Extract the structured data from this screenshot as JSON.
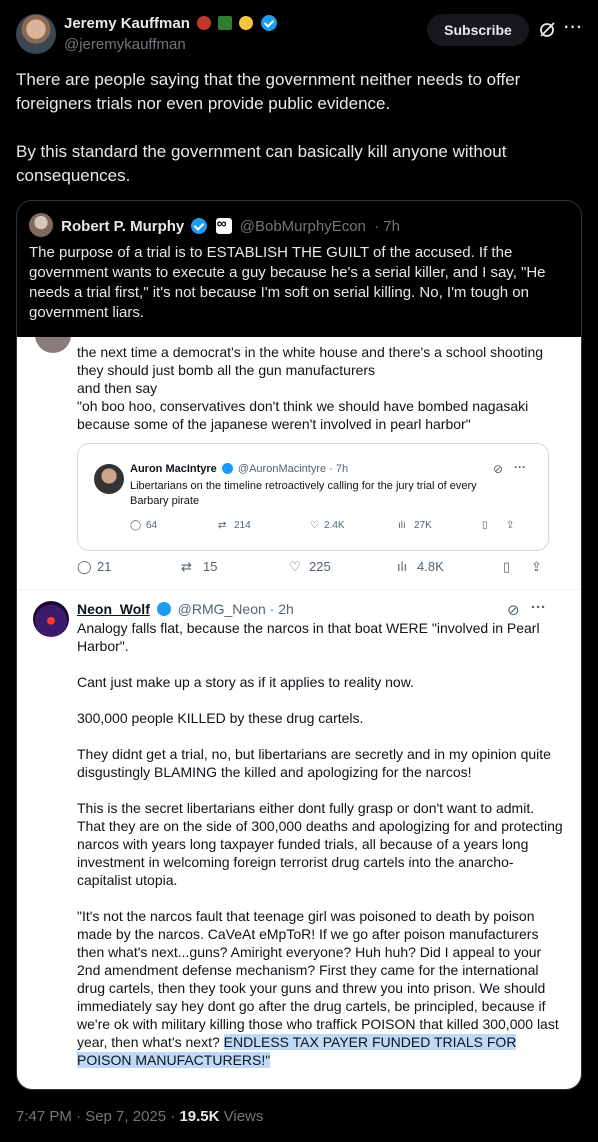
{
  "author": {
    "name": "Jeremy Kauffman",
    "handle": "@jeremykauffman"
  },
  "header": {
    "subscribe_label": "Subscribe",
    "grok_icon": "grok-icon",
    "more_icon": "more-icon"
  },
  "tweet": {
    "paragraphs": [
      "There are people saying that the government neither needs to offer foreigners trials nor even provide public evidence.",
      "By this standard the government can basically kill anyone without consequences."
    ]
  },
  "quote": {
    "name": "Robert P. Murphy",
    "handle": "@BobMurphyEcon",
    "time": "· 7h",
    "text": "The purpose of a trial is to ESTABLISH THE GUILT of the accused. If the government wants to execute a guy because he's a serial killer, and I say, \"He needs a trial first,\" it's not because I'm soft on serial killing. No, I'm tough on government liars."
  },
  "screenshot": {
    "top_text": [
      "the next time a democrat's in the white house and there's a school shooting they should just bomb all the gun manufacturers",
      "and then say",
      "\"oh boo hoo, conservatives don't think we should have bombed nagasaki because some of the japanese weren't involved in pearl harbor\""
    ],
    "inner": {
      "name": "Auron MacIntyre",
      "handle": "@AuronMacintyre · 7h",
      "text": "Libertarians on the timeline retroactively calling for the jury trial of every Barbary pirate",
      "replies": "64",
      "reposts": "214",
      "likes": "2.4K",
      "views": "27K"
    },
    "actions": {
      "replies": "21",
      "reposts": "15",
      "likes": "225",
      "views": "4.8K"
    },
    "reply": {
      "name": "Neon_Wolf",
      "handle": "@RMG_Neon · 2h",
      "paragraphs": [
        "Analogy falls flat, because the narcos in that boat WERE \"involved in Pearl Harbor\".",
        "Cant just make up a story as if it applies to reality now.",
        "300,000 people KILLED by these drug cartels.",
        "They didnt get a trial, no, but libertarians are secretly and in my opinion quite disgustingly BLAMING the killed and apologizing for the narcos!",
        "This is the secret libertarians either dont fully grasp or don't want to admit. That they are on the side of 300,000 deaths and apologizing for and protecting narcos with years long taxpayer funded trials, all because of a years long investment in welcoming foreign terrorist drug cartels into the anarcho-capitalist utopia."
      ],
      "last_paragraph": "\"It's not the narcos fault that teenage girl was poisoned to death by poison made by the narcos.  CaVeAt eMpToR!  If we go after poison manufacturers then what's next...guns? Amiright everyone?  Huh huh?  Did I appeal to your 2nd amendment defense mechanism?  First they came for the international drug cartels, then they took your guns and threw you into prison.  We should immediately say hey dont go after the drug cartels, be principled, because if we're ok with military killing those who traffick POISON that killed 300,000 last year, then what's next? ",
      "highlight": "ENDLESS TAX PAYER FUNDED TRIALS FOR POISON MANUFACTURERS!\""
    }
  },
  "meta": {
    "time": "7:47 PM · Sep 7, 2025 · ",
    "views_count": "19.5K",
    "views_label": " Views"
  },
  "colors": {
    "background": "#000000",
    "text": "#e7e9ea",
    "secondary": "#71767b",
    "verified": "#1d9bf0",
    "highlight": "#bfd9f7"
  }
}
